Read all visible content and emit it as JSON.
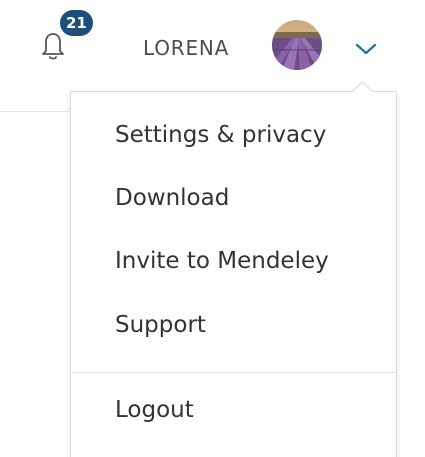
{
  "header": {
    "notifications": {
      "icon": "bell-icon",
      "count": "21",
      "badge_color": "#1d4f7a"
    },
    "user": {
      "name": "LORENA",
      "avatar": "lavender-field-avatar",
      "menu_icon": "chevron-down-icon",
      "accent_color": "#1f6f9f"
    }
  },
  "dropdown": {
    "items": [
      {
        "label": "Settings & privacy"
      },
      {
        "label": "Download"
      },
      {
        "label": "Invite to Mendeley"
      },
      {
        "label": "Support"
      },
      {
        "label": "Logout"
      }
    ]
  }
}
